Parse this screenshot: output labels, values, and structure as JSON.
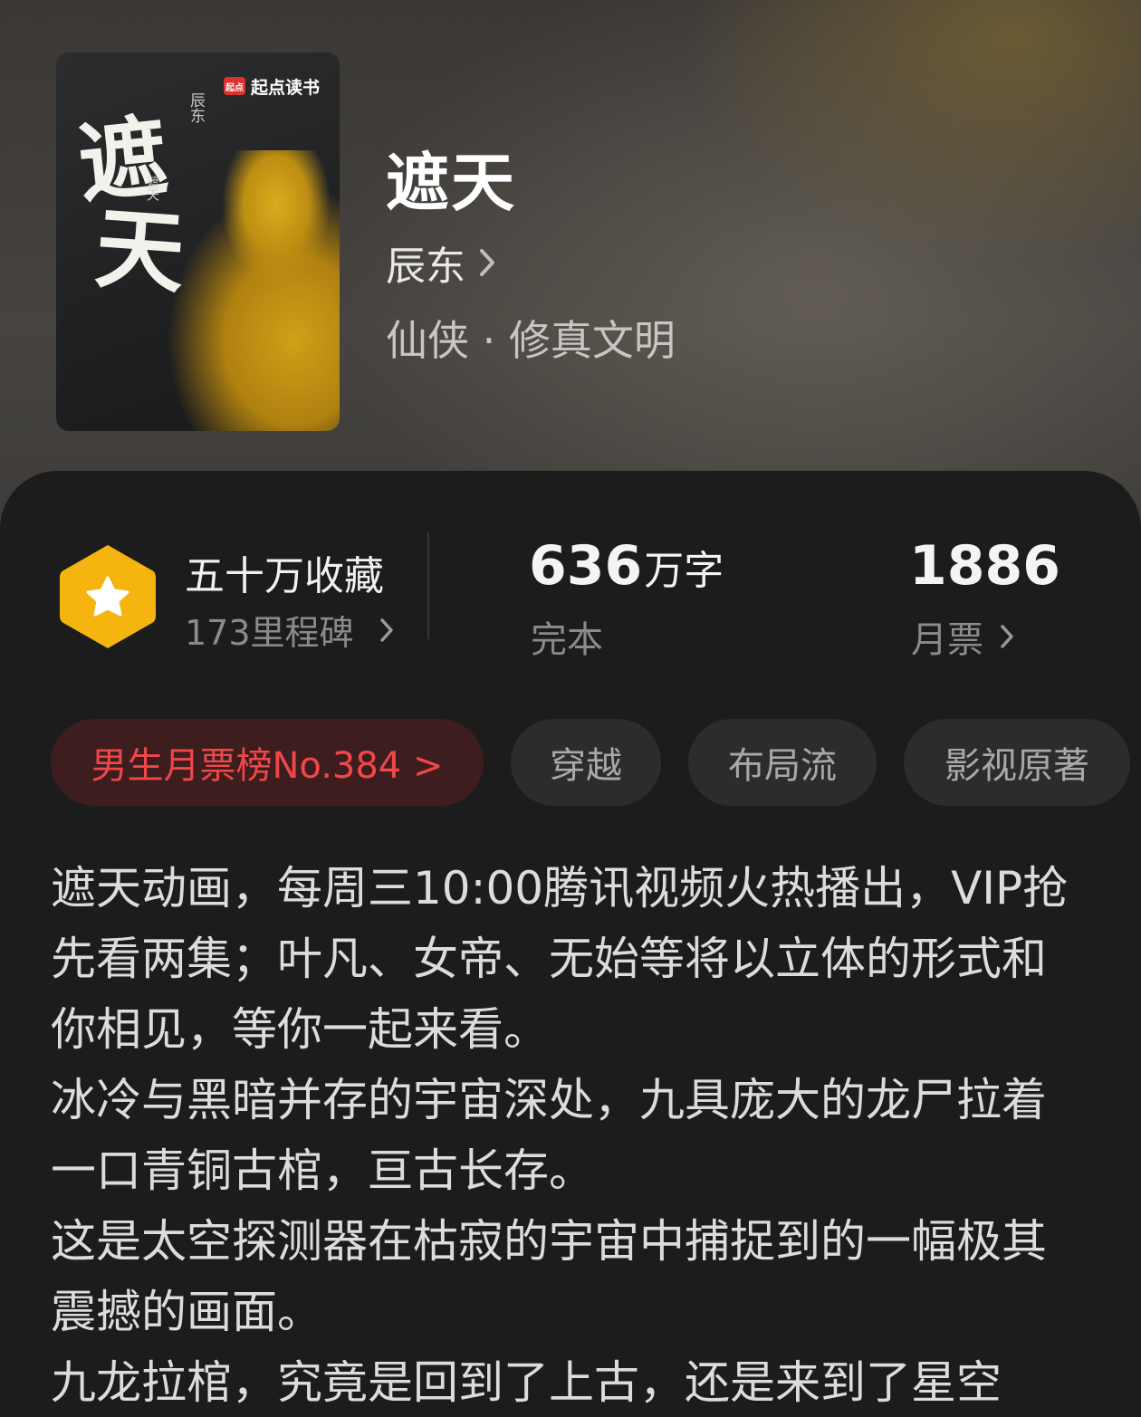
{
  "cover": {
    "publisher_badge": "起点读书",
    "title_char_1": "遮",
    "title_char_2": "天",
    "vertical_author": "辰东",
    "vertical_small": "遮天"
  },
  "book": {
    "title": "遮天",
    "author": "辰东",
    "genre": "仙侠 · 修真文明"
  },
  "stats": {
    "favorites": {
      "title": "五十万收藏",
      "sub": "173里程碑"
    },
    "words": {
      "number": "636",
      "unit": "万字",
      "status": "完本"
    },
    "monthly_votes": {
      "number": "1886",
      "label": "月票"
    }
  },
  "tags": {
    "rank": "男生月票榜No.384 >",
    "items": [
      "穿越",
      "布局流",
      "影视原著"
    ]
  },
  "description": [
    "遮天动画，每周三10:00腾讯视频火热播出，VIP抢先看两集；叶凡、女帝、无始等将以立体的形式和你相见，等你一起来看。",
    "冰冷与黑暗并存的宇宙深处，九具庞大的龙尸拉着一口青铜古棺，亘古长存。",
    "这是太空探测器在枯寂的宇宙中捕捉到的一幅极其震撼的画面。",
    "九龙拉棺，究竟是回到了上古，还是来到了星空"
  ],
  "colors": {
    "accent_red": "#f0474a",
    "badge_gold": "#f6b40e",
    "panel_bg": "#1c1c1d"
  }
}
